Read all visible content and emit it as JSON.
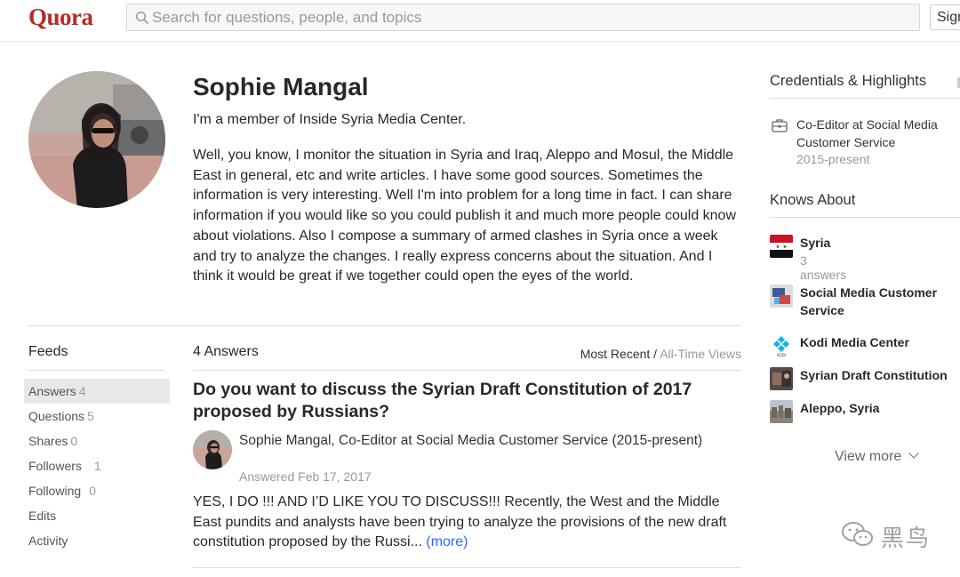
{
  "header": {
    "logo": "Quora",
    "search_placeholder": "Search for questions, people, and topics",
    "signin_label": "Sign"
  },
  "profile": {
    "name": "Sophie Mangal",
    "tagline": "I'm a member of Inside Syria Media Center.",
    "bio": "Well, you know, I monitor the situation in Syria and Iraq, Aleppo and Mosul, the Middle East in general, etc and write articles. I have some good sources. Sometimes the information is very interesting. Well I'm into problem for a long time in fact. I can share information if you would like so you could publish it and much more people could know about violations. Also I compose a summary of armed clashes in Syria once a week and try to analyze the changes. I really express concerns about the situation. And I think it would be great if we together could open the eyes of the world."
  },
  "feeds": {
    "title": "Feeds",
    "items": [
      {
        "label": "Answers",
        "count": "4"
      },
      {
        "label": "Questions",
        "count": "5"
      },
      {
        "label": "Shares",
        "count": "0"
      },
      {
        "label": "Followers",
        "count": "1"
      },
      {
        "label": "Following",
        "count": "0"
      },
      {
        "label": "Edits",
        "count": ""
      },
      {
        "label": "Activity",
        "count": ""
      }
    ]
  },
  "answers": {
    "count_label": "4 Answers",
    "sort_recent": "Most Recent",
    "sort_sep": " / ",
    "sort_views": "All-Time Views",
    "first": {
      "question": "Do you want to discuss the Syrian Draft Constitution of 2017 proposed by Russians?",
      "author": "Sophie Mangal, Co-Editor at Social Media Customer Service (2015-present)",
      "date": "Answered Feb 17, 2017",
      "text": "YES, I DO !!! AND I’D LIKE YOU TO DISCUSS!!! Recently, the West and the Middle East pundits and analysts have been trying to analyze the provisions of the new draft constitution proposed by the Russi...",
      "more": "(more)"
    }
  },
  "sidebar": {
    "credentials_title": "Credentials & Highlights",
    "credential": {
      "icon": "briefcase-icon",
      "text": "Co-Editor at Social Media Customer Service",
      "date": "2015-present"
    },
    "knows_title": "Knows About",
    "knows": [
      {
        "name": "Syria",
        "sub": "3 answers"
      },
      {
        "name": "Social Media Customer Service",
        "sub": ""
      },
      {
        "name": "Kodi Media Center",
        "sub": ""
      },
      {
        "name": "Syrian Draft Constitution",
        "sub": ""
      },
      {
        "name": "Aleppo, Syria",
        "sub": ""
      }
    ],
    "view_more": "View more"
  },
  "watermark": "黑鸟",
  "colors": {
    "brand": "#b92b27",
    "link": "#2e69ff"
  }
}
